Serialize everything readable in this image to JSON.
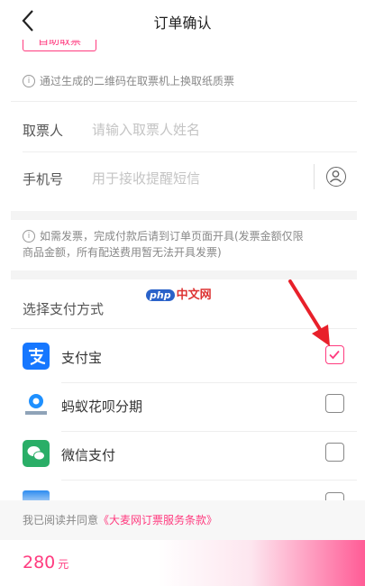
{
  "header": {
    "title": "订单确认"
  },
  "pickup": {
    "tag_label": "自助取票",
    "note": "通过生成的二维码在取票机上换取纸质票"
  },
  "form": {
    "name_label": "取票人",
    "name_placeholder": "请输入取票人姓名",
    "phone_label": "手机号",
    "phone_placeholder": "用于接收提醒短信"
  },
  "invoice": {
    "note_line1": "如需发票，完成付款后请到订单页面开具(发票金额仅限",
    "note_line2": "商品金额，所有配送费用暂无法开具发票)"
  },
  "watermark": {
    "php": "php",
    "text": "中文网"
  },
  "payment": {
    "title": "选择支付方式",
    "methods": [
      {
        "label": "支付宝",
        "checked": true,
        "icon": "alipay-icon",
        "color": "#1677ff"
      },
      {
        "label": "蚂蚁花呗分期",
        "checked": false,
        "icon": "huabei-icon",
        "color": "#1e90ff"
      },
      {
        "label": "微信支付",
        "checked": false,
        "icon": "wechat-icon",
        "color": "#2aae67"
      }
    ]
  },
  "agreement": {
    "prefix": "我已阅读并同意",
    "link": "《大麦网订票服务条款》"
  },
  "footer": {
    "price": "280",
    "unit": "元"
  },
  "colors": {
    "accent": "#ff3b7f",
    "arrow": "#e8202a"
  }
}
